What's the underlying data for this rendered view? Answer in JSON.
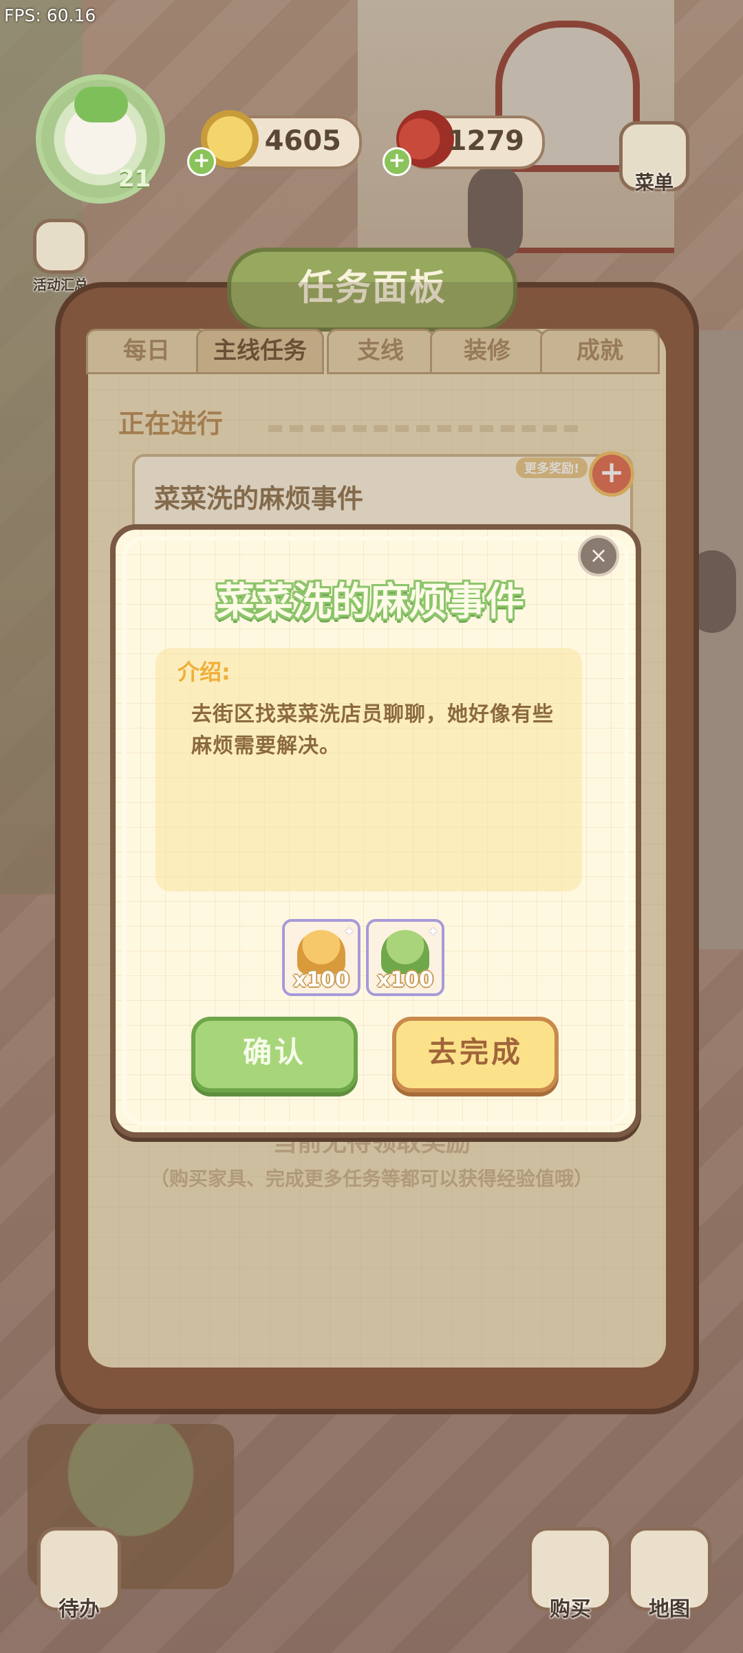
{
  "hud": {
    "fps": "FPS: 60.16",
    "level": "21",
    "coins": "4605",
    "gems": "1279",
    "menu_label": "菜单",
    "event_label": "活动汇总"
  },
  "panel": {
    "title": "任务面板",
    "tabs": [
      "每日",
      "主线任务",
      "支线",
      "装修",
      "成就"
    ],
    "section_title": "正在进行",
    "task_title": "菜菜洗的麻烦事件",
    "more_rewards": "更多奖励!",
    "empty_text": "当前无待领取奖励",
    "empty_hint": "（购买家具、完成更多任务等都可以获得经验值哦）"
  },
  "dialog": {
    "title": "菜菜洗的麻烦事件",
    "intro_label": "介绍:",
    "intro_text": "去街区找菜菜洗店员聊聊，她好像有些麻烦需要解决。",
    "rewards": [
      {
        "icon": "gold-pile-icon",
        "count": "x100"
      },
      {
        "icon": "experience-icon",
        "count": "x100"
      }
    ],
    "confirm_label": "确认",
    "go_label": "去完成"
  },
  "bottom": {
    "todo_label": "待办",
    "buy_label": "购买",
    "map_label": "地图"
  },
  "colors": {
    "accent_green": "#8cc56b",
    "accent_yellow": "#fbe28a",
    "panel_brown": "#8b5a40"
  }
}
